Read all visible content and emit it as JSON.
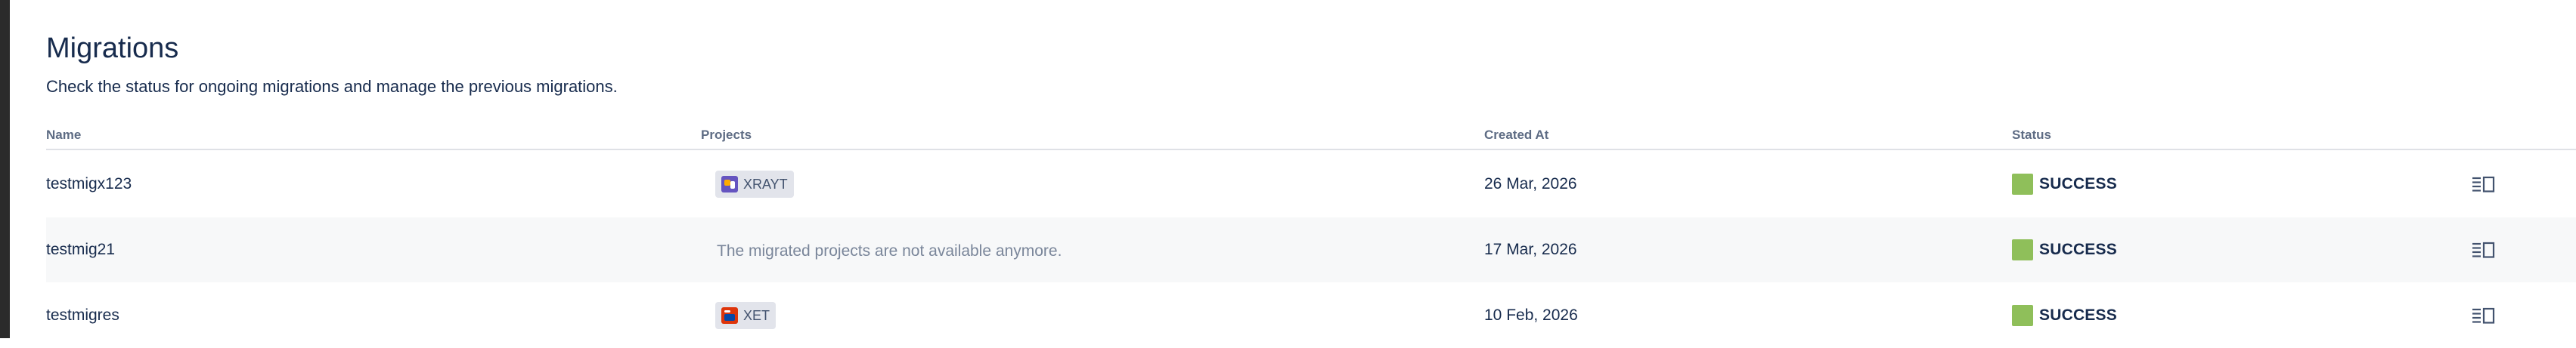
{
  "page": {
    "title": "Migrations",
    "subtitle": "Check the status for ongoing migrations and manage the previous migrations."
  },
  "table": {
    "headers": {
      "name": "Name",
      "projects": "Projects",
      "created_at": "Created At",
      "status": "Status"
    },
    "rows": [
      {
        "name": "testmigx123",
        "project": {
          "key": "XRAYT",
          "icon": "project-avatar-icon",
          "icon_color": "#6554c0",
          "accent_color": "#ffab00"
        },
        "created_at": "26 Mar, 2026",
        "status": "SUCCESS",
        "status_color": "#8fbf5a",
        "action_icon": "details-panel-icon"
      },
      {
        "name": "testmig21",
        "project_unavailable_text": "The migrated projects are not available anymore.",
        "created_at": "17 Mar, 2026",
        "status": "SUCCESS",
        "status_color": "#8fbf5a",
        "action_icon": "details-panel-icon"
      },
      {
        "name": "testmigres",
        "project": {
          "key": "XET",
          "icon": "project-avatar-icon",
          "icon_color": "#de350b",
          "accent_color": "#0747a6"
        },
        "created_at": "10 Feb, 2026",
        "status": "SUCCESS",
        "status_color": "#8fbf5a",
        "action_icon": "details-panel-icon"
      }
    ]
  }
}
